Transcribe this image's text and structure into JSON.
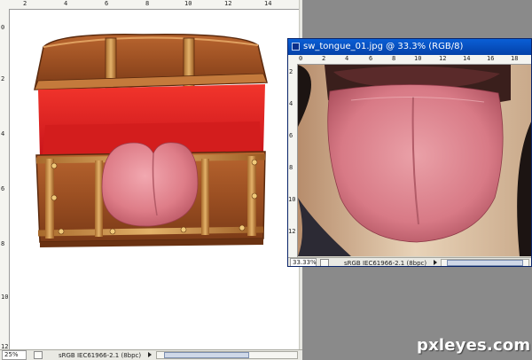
{
  "main_window": {
    "zoom": "25%",
    "profile": "sRGB IEC61966-2.1 (8bpc)",
    "ruler_top_labels": [
      "2",
      "4",
      "6",
      "8",
      "10",
      "12",
      "14"
    ],
    "ruler_left_labels": [
      "0",
      "2",
      "4",
      "6",
      "8",
      "10",
      "12"
    ]
  },
  "tongue_window": {
    "title": "sw_tongue_01.jpg @ 33.3% (RGB/8)",
    "zoom": "33.33%",
    "profile": "sRGB IEC61966-2.1 (8bpc)",
    "ruler_top_labels": [
      "0",
      "2",
      "4",
      "6",
      "8",
      "10",
      "12",
      "14",
      "16",
      "18"
    ],
    "ruler_left_labels": [
      "2",
      "4",
      "6",
      "8",
      "10",
      "12"
    ]
  },
  "watermark": "pxleyes.com",
  "colors": {
    "titlebar": "#0a5fd6",
    "chest_wood": "#9b4f22",
    "chest_interior": "#e2211f",
    "tongue": "#d4707a",
    "workspace": "#8a8a8a"
  }
}
